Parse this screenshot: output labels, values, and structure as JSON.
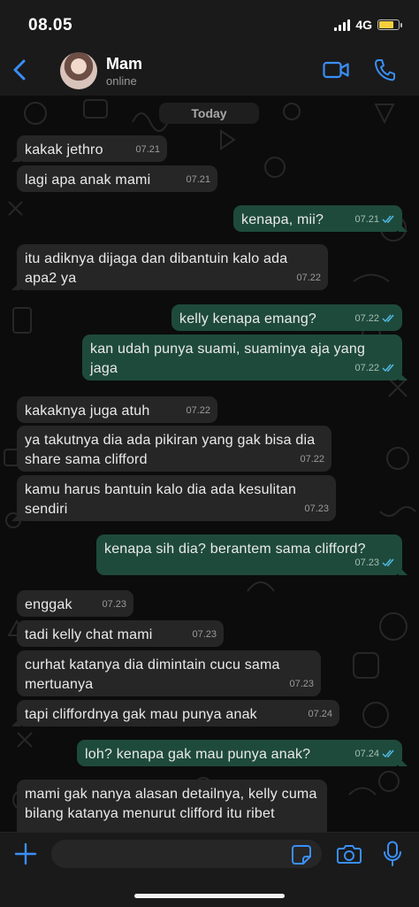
{
  "status_bar": {
    "time": "08.05",
    "network": "4G",
    "battery_level": 0.8
  },
  "header": {
    "contact_name": "Mam",
    "contact_status": "online",
    "accent_color": "#3a8ff7"
  },
  "chat": {
    "date_divider": "Today",
    "messages": [
      {
        "dir": "in",
        "text": "kakak jethro",
        "time": "07.21"
      },
      {
        "dir": "in",
        "text": "lagi apa anak mami",
        "time": "07.21"
      },
      {
        "dir": "out",
        "text": "kenapa, mii?",
        "time": "07.21"
      },
      {
        "dir": "in",
        "text": "itu adiknya dijaga dan dibantuin kalo ada apa2 ya",
        "time": "07.22"
      },
      {
        "dir": "out",
        "text": "kelly kenapa emang?",
        "time": "07.22"
      },
      {
        "dir": "out",
        "text": "kan udah punya suami, suaminya aja yang jaga",
        "time": "07.22"
      },
      {
        "dir": "in",
        "text": "kakaknya juga atuh",
        "time": "07.22"
      },
      {
        "dir": "in",
        "text": "ya takutnya dia ada pikiran yang gak bisa dia share sama clifford",
        "time": "07.22"
      },
      {
        "dir": "in",
        "text": "kamu harus bantuin kalo dia ada kesulitan sendiri",
        "time": "07.23"
      },
      {
        "dir": "out",
        "text": "kenapa sih dia? berantem sama clifford?",
        "time": "07.23"
      },
      {
        "dir": "in",
        "text": "enggak",
        "time": "07.23"
      },
      {
        "dir": "in",
        "text": "tadi kelly chat mami",
        "time": "07.23"
      },
      {
        "dir": "in",
        "text": "curhat katanya dia dimintain cucu sama mertuanya",
        "time": "07.23"
      },
      {
        "dir": "in",
        "text": "tapi cliffordnya gak mau punya anak",
        "time": "07.24"
      },
      {
        "dir": "out",
        "text": "loh? kenapa gak mau punya anak?",
        "time": "07.24"
      },
      {
        "dir": "in",
        "text": "mami gak nanya alasan detailnya, kelly cuma bilang katanya menurut clifford itu ribet",
        "time": ""
      }
    ]
  },
  "input": {
    "value": "",
    "placeholder": ""
  },
  "colors": {
    "incoming_bubble": "#262626",
    "outgoing_bubble": "#1e4a3c",
    "read_tick": "#53bdeb"
  }
}
